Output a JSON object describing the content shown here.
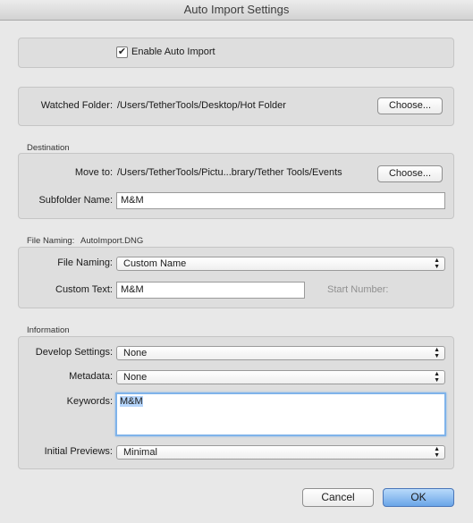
{
  "window": {
    "title": "Auto Import Settings"
  },
  "enable": {
    "label": "Enable Auto Import",
    "checked": true
  },
  "watched": {
    "label": "Watched Folder:",
    "path": "/Users/TetherTools/Desktop/Hot Folder",
    "choose": "Choose..."
  },
  "destination": {
    "section": "Destination",
    "move_label": "Move to:",
    "move_path": "/Users/TetherTools/Pictu...brary/Tether Tools/Events",
    "choose": "Choose...",
    "subfolder_label": "Subfolder Name:",
    "subfolder_value": "M&M"
  },
  "naming": {
    "section": "File Naming:",
    "example": "AutoImport.DNG",
    "file_naming_label": "File Naming:",
    "file_naming_value": "Custom Name",
    "custom_text_label": "Custom Text:",
    "custom_text_value": "M&M",
    "start_number_label": "Start Number:"
  },
  "information": {
    "section": "Information",
    "develop_label": "Develop Settings:",
    "develop_value": "None",
    "metadata_label": "Metadata:",
    "metadata_value": "None",
    "keywords_label": "Keywords:",
    "keywords_value": "M&M",
    "previews_label": "Initial Previews:",
    "previews_value": "Minimal"
  },
  "buttons": {
    "cancel": "Cancel",
    "ok": "OK"
  }
}
